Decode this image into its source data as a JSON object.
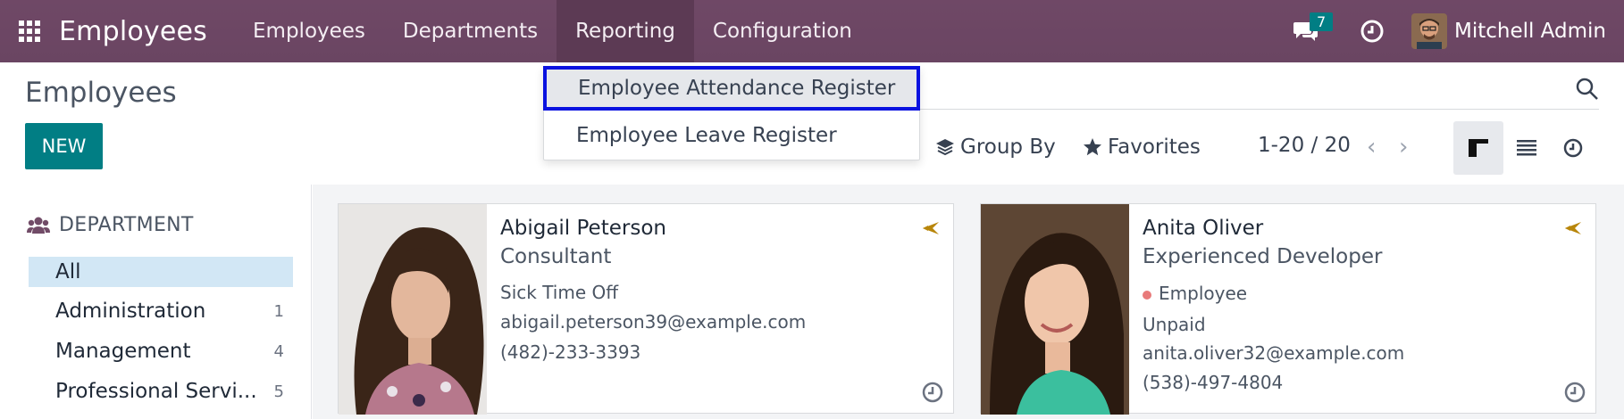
{
  "navbar": {
    "app_name": "Employees",
    "menu": [
      "Employees",
      "Departments",
      "Reporting",
      "Configuration"
    ],
    "active_menu": "Reporting",
    "chat_count": "7",
    "user_name": "Mitchell Admin"
  },
  "control_panel": {
    "title": "Employees",
    "new_label": "NEW",
    "group_by_label": "Group By",
    "favorites_label": "Favorites",
    "pager_text": "1-20 / 20",
    "views": [
      "kanban",
      "list",
      "activity"
    ],
    "active_view": "kanban"
  },
  "reporting_dropdown": {
    "items": [
      "Employee Attendance Register",
      "Employee Leave Register"
    ],
    "highlighted": "Employee Attendance Register"
  },
  "sidebar": {
    "heading": "DEPARTMENT",
    "items": [
      {
        "label": "All",
        "count": ""
      },
      {
        "label": "Administration",
        "count": "1"
      },
      {
        "label": "Management",
        "count": "4"
      },
      {
        "label": "Professional Servi...",
        "count": "5"
      }
    ]
  },
  "cards": [
    {
      "name": "Abigail Peterson",
      "job": "Consultant",
      "status": "Sick Time Off",
      "email": "abigail.peterson39@example.com",
      "phone": "(482)-233-3393"
    },
    {
      "name": "Anita Oliver",
      "job": "Experienced Developer",
      "tag": "Employee",
      "status": "Unpaid",
      "email": "anita.oliver32@example.com",
      "phone": "(538)-497-4804"
    }
  ],
  "colors": {
    "navbar": "#714b67",
    "primary": "#017e84",
    "highlight_outline": "#0a12e0",
    "sidebar_active": "#d2e7f5",
    "status_dot": "#e87a7a",
    "plane_icon": "#b8860b"
  },
  "icons": [
    "apps-grid-icon",
    "chat-icon",
    "clock-icon",
    "search-icon",
    "layers-icon",
    "star-icon",
    "chevron-left-icon",
    "chevron-right-icon",
    "kanban-view-icon",
    "list-view-icon",
    "activity-view-icon",
    "users-icon",
    "plane-icon"
  ]
}
